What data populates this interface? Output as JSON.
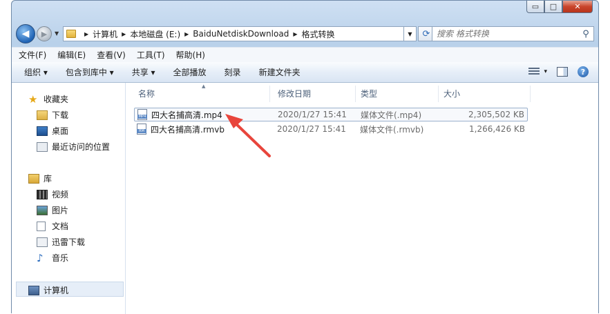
{
  "window": {
    "caption": {
      "minimize": "▭",
      "maximize": "□",
      "close": "✕"
    }
  },
  "address": {
    "crumbs": [
      "计算机",
      "本地磁盘 (E:)",
      "BaiduNetdiskDownload",
      "格式转换"
    ],
    "search_placeholder": "搜索 格式转换"
  },
  "menu": [
    "文件(F)",
    "编辑(E)",
    "查看(V)",
    "工具(T)",
    "帮助(H)"
  ],
  "toolbar": {
    "organize": "组织 ▾",
    "include_library": "包含到库中 ▾",
    "share": "共享 ▾",
    "play_all": "全部播放",
    "burn": "刻录",
    "new_folder": "新建文件夹",
    "view_dropdown": "▾"
  },
  "nav": {
    "favorites": "收藏夹",
    "downloads": "下载",
    "desktop": "桌面",
    "recent": "最近访问的位置",
    "libraries": "库",
    "videos": "视频",
    "pictures": "图片",
    "documents": "文档",
    "thunder": "迅雷下载",
    "music": "音乐",
    "computer": "计算机"
  },
  "columns": {
    "name": "名称",
    "modified": "修改日期",
    "type": "类型",
    "size": "大小"
  },
  "files": [
    {
      "name": "四大名捕高清.mp4",
      "modified": "2020/1/27 15:41",
      "type": "媒体文件(.mp4)",
      "size": "2,305,502 KB",
      "icon_tag": "MP4"
    },
    {
      "name": "四大名捕高清.rmvb",
      "modified": "2020/1/27 15:41",
      "type": "媒体文件(.rmvb)",
      "size": "1,266,426 KB",
      "icon_tag": "RM"
    }
  ],
  "colors": {
    "annotation_arrow": "#e8453c"
  }
}
